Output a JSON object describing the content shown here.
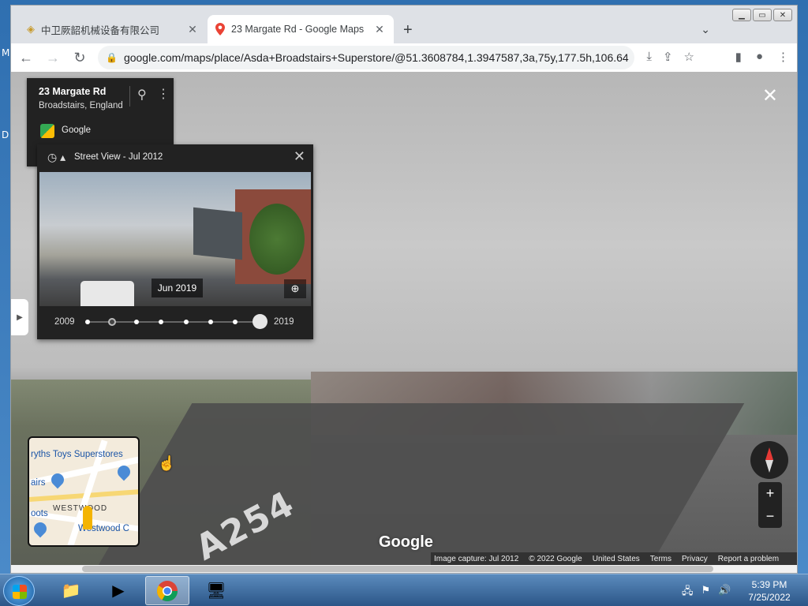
{
  "desktop": {
    "letters": [
      "M",
      "D"
    ]
  },
  "window": {
    "controls": [
      "minimize",
      "maximize",
      "close"
    ]
  },
  "tabs": [
    {
      "title": "中卫厥韶机械设备有限公司",
      "close": "✕",
      "icon": "company-favicon"
    },
    {
      "title": "23 Margate Rd - Google Maps",
      "close": "✕",
      "icon": "maps-pin-favicon"
    }
  ],
  "newtab": "+",
  "toolbar": {
    "url": "google.com/maps/place/Asda+Broadstairs+Superstore/@51.3608784,1.3947587,3a,75y,177.5h,106.64t..."
  },
  "info_card": {
    "title": "23 Margate Rd",
    "subtitle": "Broadstairs, England",
    "brand": "Google"
  },
  "street_view_panel": {
    "heading": "Street View - Jul 2012",
    "thumb_date": "Jun 2019",
    "year_start": "2009",
    "year_end": "2019",
    "timeline_points": 8,
    "selected_point_index": 1
  },
  "road_marking": "A254",
  "minimap": {
    "labels": [
      "ryths Toys Superstores",
      "airs",
      "WESTWOOD",
      "oots",
      "Westwood C"
    ]
  },
  "google_watermark": "Google",
  "footer": {
    "capture": "Image capture: Jul 2012",
    "copyright": "© 2022 Google",
    "region": "United States",
    "terms": "Terms",
    "privacy": "Privacy",
    "report": "Report a problem"
  },
  "taskbar": {
    "time": "5:39 PM",
    "date": "7/25/2022"
  }
}
